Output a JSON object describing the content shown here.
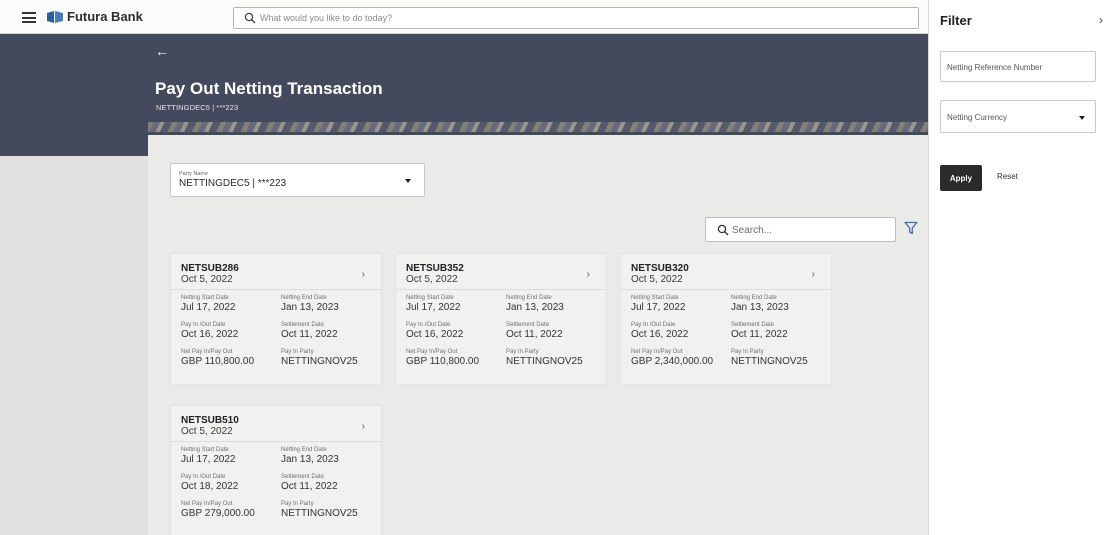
{
  "header": {
    "brand": "Futura Bank",
    "search_placeholder": "What would you like to do today?"
  },
  "page": {
    "title": "Pay Out Netting Transaction",
    "subtitle": "NETTINGDEC5 | ***223"
  },
  "party_select": {
    "label": "Party Name",
    "value": "NETTINGDEC5 | ***223"
  },
  "list": {
    "search_placeholder": "Search..."
  },
  "field_labels": {
    "start": "Netting Start Date",
    "end": "Netting End Date",
    "payinout": "Pay In /Out Date",
    "settlement": "Settlement Date",
    "net": "Net Pay In/Pay Out",
    "party": "Pay In Party"
  },
  "cards": [
    {
      "id": "NETSUB286",
      "date": "Oct 5, 2022",
      "start": "Jul 17, 2022",
      "end": "Jan 13, 2023",
      "payinout": "Oct 16, 2022",
      "settlement": "Oct 11, 2022",
      "net": "GBP 110,800.00",
      "party": "NETTINGNOV25"
    },
    {
      "id": "NETSUB352",
      "date": "Oct 5, 2022",
      "start": "Jul 17, 2022",
      "end": "Jan 13, 2023",
      "payinout": "Oct 16, 2022",
      "settlement": "Oct 11, 2022",
      "net": "GBP 110,800.00",
      "party": "NETTINGNOV25"
    },
    {
      "id": "NETSUB320",
      "date": "Oct 5, 2022",
      "start": "Jul 17, 2022",
      "end": "Jan 13, 2023",
      "payinout": "Oct 16, 2022",
      "settlement": "Oct 11, 2022",
      "net": "GBP 2,340,000.00",
      "party": "NETTINGNOV25"
    },
    {
      "id": "NETSUB510",
      "date": "Oct 5, 2022",
      "start": "Jul 17, 2022",
      "end": "Jan 13, 2023",
      "payinout": "Oct 18, 2022",
      "settlement": "Oct 11, 2022",
      "net": "GBP 279,000.00",
      "party": "NETTINGNOV25"
    }
  ],
  "filter": {
    "title": "Filter",
    "reference_placeholder": "Netting Reference Number",
    "currency_placeholder": "Netting Currency",
    "apply_label": "Apply",
    "reset_label": "Reset"
  },
  "icons": {
    "menu": "hamburger-menu-icon",
    "logo": "bank-logo-icon",
    "search": "search-icon",
    "back": "back-arrow-icon",
    "filter": "filter-icon",
    "chevron": "chevron-right-icon",
    "close": "close-icon"
  },
  "colors": {
    "header_band": "#444a5e",
    "logo_blue": "#2f5d9a",
    "filter_icon": "#3d6fb0",
    "apply_button": "#2b2b2b"
  }
}
